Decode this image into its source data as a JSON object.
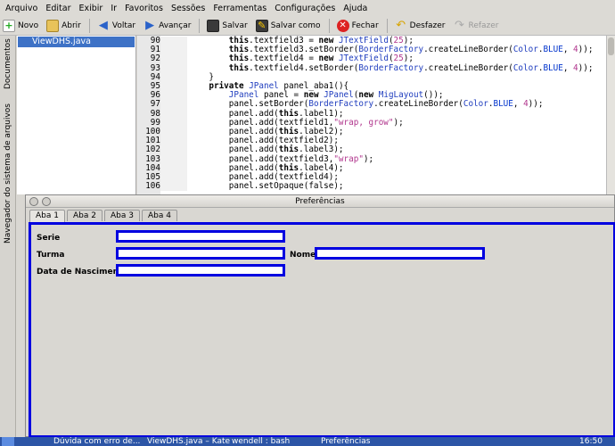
{
  "menu": [
    "Arquivo",
    "Editar",
    "Exibir",
    "Ir",
    "Favoritos",
    "Sessões",
    "Ferramentas",
    "Configurações",
    "Ajuda"
  ],
  "toolbar": {
    "novo": "Novo",
    "abrir": "Abrir",
    "voltar": "Voltar",
    "avancar": "Avançar",
    "salvar": "Salvar",
    "salvar_como": "Salvar como",
    "fechar": "Fechar",
    "desfazer": "Desfazer",
    "refazer": "Refazer"
  },
  "left_tabs": {
    "documentos": "Documentos",
    "navegador": "Navegador do sistema de arquivos"
  },
  "files": [
    "ViewDHS.java"
  ],
  "code_lines": [
    {
      "n": "90",
      "t": "        this.textfield3 = new JTextField(25);"
    },
    {
      "n": "91",
      "t": "        this.textfield3.setBorder(BorderFactory.createLineBorder(Color.BLUE, 4));"
    },
    {
      "n": "92",
      "t": "        this.textfield4 = new JTextField(25);"
    },
    {
      "n": "93",
      "t": "        this.textfield4.setBorder(BorderFactory.createLineBorder(Color.BLUE, 4));"
    },
    {
      "n": "94",
      "t": "    }"
    },
    {
      "n": "95",
      "t": "    private JPanel panel_aba1(){"
    },
    {
      "n": "96",
      "t": "        JPanel panel = new JPanel(new MigLayout());"
    },
    {
      "n": "97",
      "t": "        panel.setBorder(BorderFactory.createLineBorder(Color.BLUE, 4));"
    },
    {
      "n": "98",
      "t": "        panel.add(this.label1);"
    },
    {
      "n": "99",
      "t": "        panel.add(textfield1,\"wrap, grow\");"
    },
    {
      "n": "100",
      "t": "        panel.add(this.label2);"
    },
    {
      "n": "101",
      "t": "        panel.add(textfield2);"
    },
    {
      "n": "102",
      "t": "        panel.add(this.label3);"
    },
    {
      "n": "103",
      "t": "        panel.add(textfield3,\"wrap\");"
    },
    {
      "n": "104",
      "t": "        panel.add(this.label4);"
    },
    {
      "n": "105",
      "t": "        panel.add(textfield4);"
    },
    {
      "n": "106",
      "t": "        panel.setOpaque(false);"
    }
  ],
  "dialog": {
    "title": "Preferências",
    "tabs": [
      "Aba 1",
      "Aba 2",
      "Aba 3",
      "Aba 4"
    ],
    "labels": {
      "serie": "Serie",
      "turma": "Turma",
      "nome": "Nome",
      "data": "Data de Nascimento"
    }
  },
  "taskbar": {
    "items": [
      "Dúvida com erro de...",
      "ViewDHS.java – Kate",
      "wendell : bash",
      "Preferências"
    ],
    "clock": "16:50"
  },
  "colors": {
    "accent": "#0000e0",
    "selection": "#3e72c6",
    "taskbar": "#2c55a6"
  }
}
